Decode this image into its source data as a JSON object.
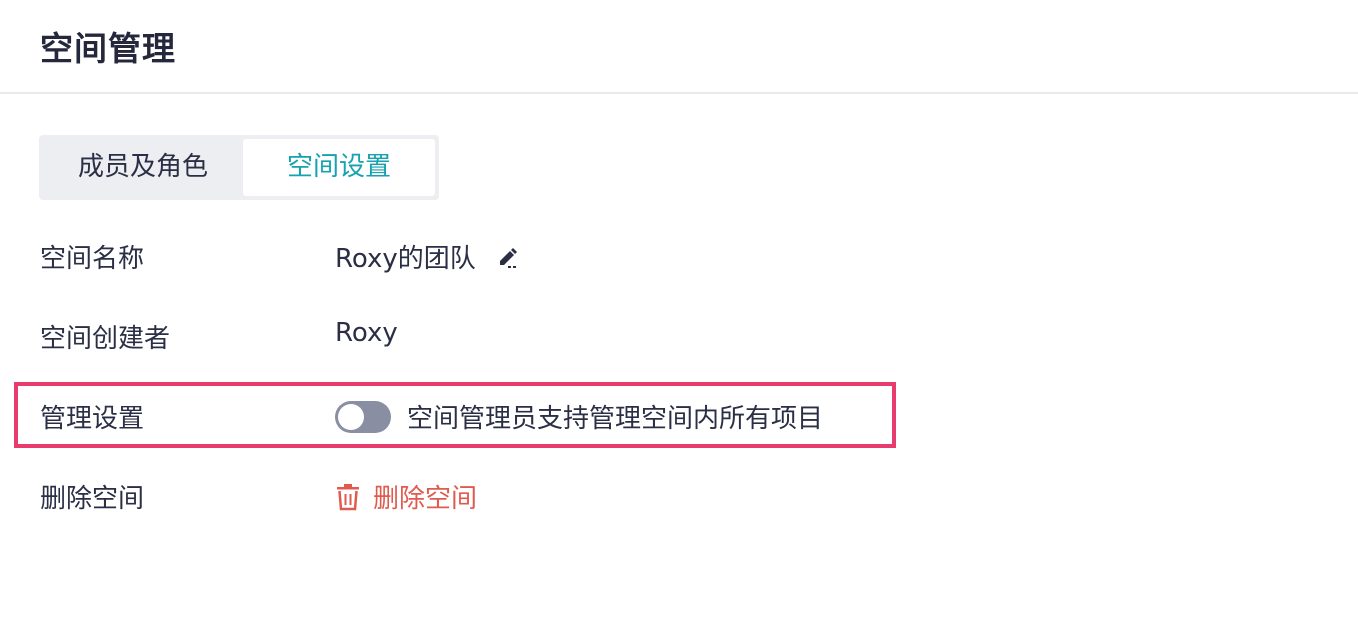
{
  "header": {
    "title": "空间管理"
  },
  "tabs": [
    {
      "label": "成员及角色",
      "active": false
    },
    {
      "label": "空间设置",
      "active": true
    }
  ],
  "settings": {
    "space_name": {
      "label": "空间名称",
      "value": "Roxy的团队",
      "icon": "edit-icon"
    },
    "creator": {
      "label": "空间创建者",
      "value": "Roxy"
    },
    "admin": {
      "label": "管理设置",
      "toggle_on": false,
      "toggle_text": "空间管理员支持管理空间内所有项目"
    },
    "delete": {
      "label": "删除空间",
      "action_label": "删除空间",
      "icon": "trash-icon"
    }
  },
  "colors": {
    "accent": "#17a2b0",
    "danger": "#e05b4f",
    "highlight": "#e83b6e",
    "toggle_off": "#8a8ea3"
  }
}
